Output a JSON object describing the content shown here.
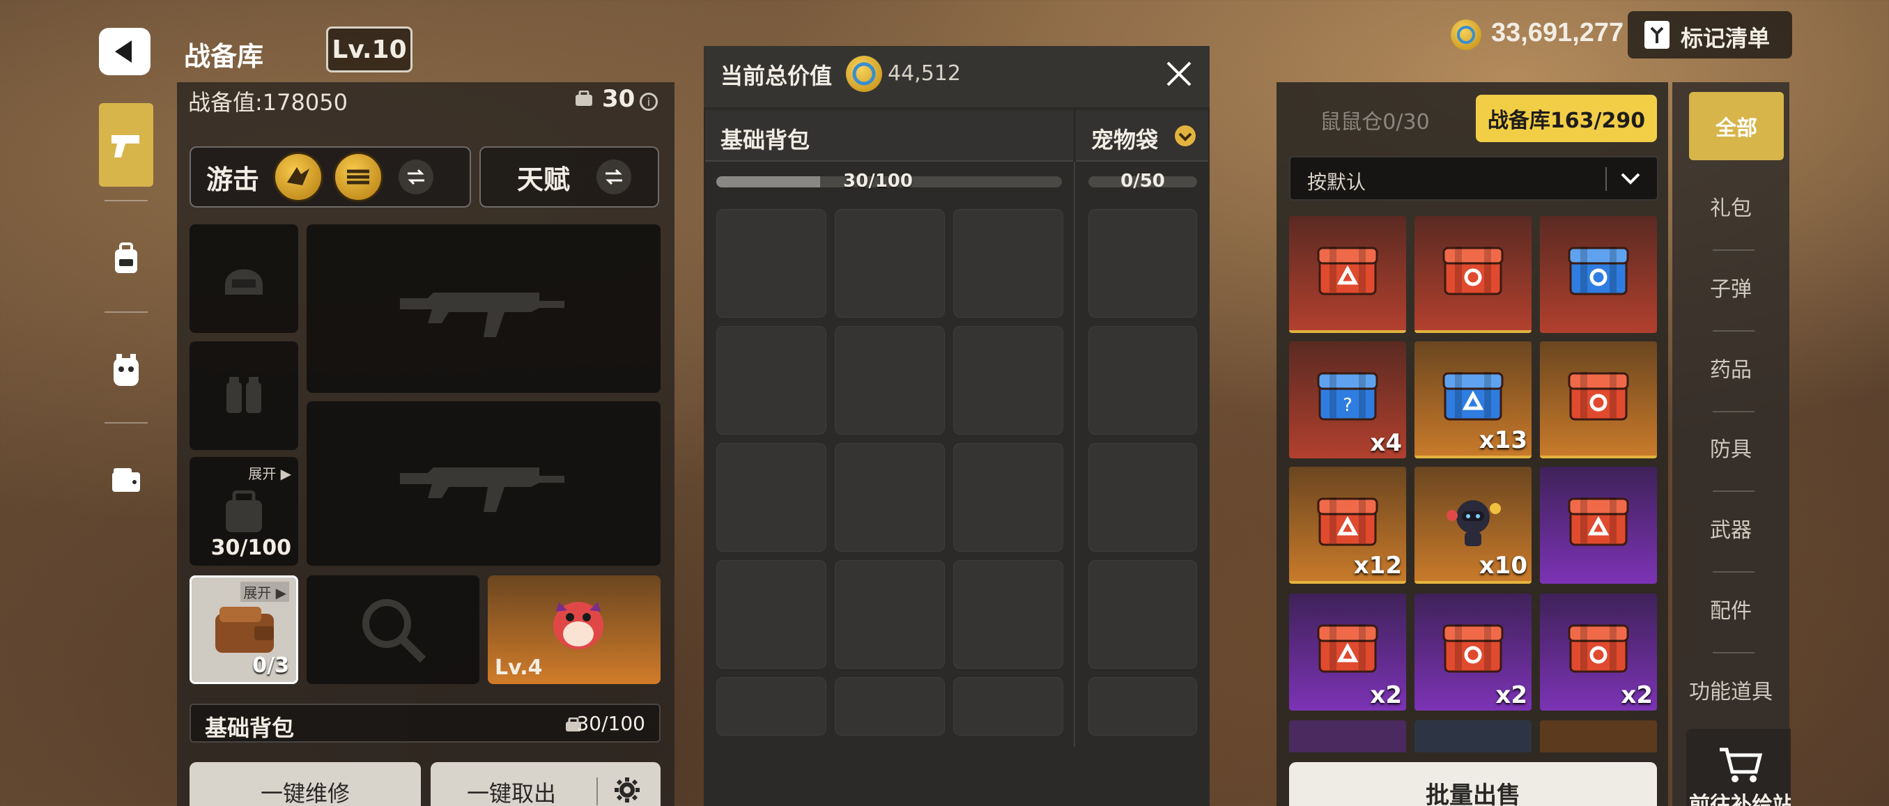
{
  "header": {
    "title": "战备库",
    "level": "Lv.10",
    "gold": "33,691,277",
    "mark_list": "标记清单"
  },
  "equipment": {
    "power_label": "战备值:178050",
    "capacity_count": "30",
    "class_label": "游击",
    "talent_label": "天赋",
    "expand_label": "展开 ▶",
    "backpack_capacity": "30/100",
    "wallet_count": "0/3",
    "pet_level": "Lv.4",
    "basic_backpack_label": "基础背包",
    "basic_backpack_capacity": "30/100",
    "repair_all": "一键维修",
    "take_all": "一键取出"
  },
  "backpack_panel": {
    "total_value_label": "当前总价值",
    "total_value": "44,512",
    "tab_basic": "基础背包",
    "tab_pet": "宠物袋",
    "basic_capacity": "30/100",
    "basic_progress": 0.3,
    "pet_capacity": "0/50"
  },
  "storage": {
    "tab_hamster": "鼠鼠仓0/30",
    "tab_armory": "战备库163/290",
    "sort_label": "按默认",
    "batch_sell": "批量出售",
    "items": [
      {
        "name": "red-crate-triangle",
        "bg": "red",
        "qty": ""
      },
      {
        "name": "red-crate-circle",
        "bg": "red",
        "qty": ""
      },
      {
        "name": "blue-crate-circle",
        "bg": "red",
        "qty": ""
      },
      {
        "name": "blue-crate-question",
        "bg": "red",
        "qty": "x4"
      },
      {
        "name": "blue-crate-triangle",
        "bg": "orange",
        "qty": "x13"
      },
      {
        "name": "red-crate-circle",
        "bg": "orange",
        "qty": ""
      },
      {
        "name": "red-crate-triangle",
        "bg": "orange",
        "qty": "x12"
      },
      {
        "name": "robot-toy",
        "bg": "orange",
        "qty": "x10"
      },
      {
        "name": "red-crate-triangle",
        "bg": "purple",
        "qty": ""
      },
      {
        "name": "red-crate-triangle",
        "bg": "purple",
        "qty": "x2"
      },
      {
        "name": "red-crate-circle",
        "bg": "purple",
        "qty": "x2"
      },
      {
        "name": "red-crate-circle",
        "bg": "purple",
        "qty": "x2"
      }
    ]
  },
  "categories": [
    "全部",
    "礼包",
    "子弹",
    "药品",
    "防具",
    "武器",
    "配件",
    "功能道具"
  ],
  "supply_station": "前往补给站",
  "colors": {
    "accent_gold": "#d7b54a",
    "tile_red": "#b2402e",
    "tile_orange": "#c87a2a",
    "tile_purple": "#7c33b5"
  }
}
